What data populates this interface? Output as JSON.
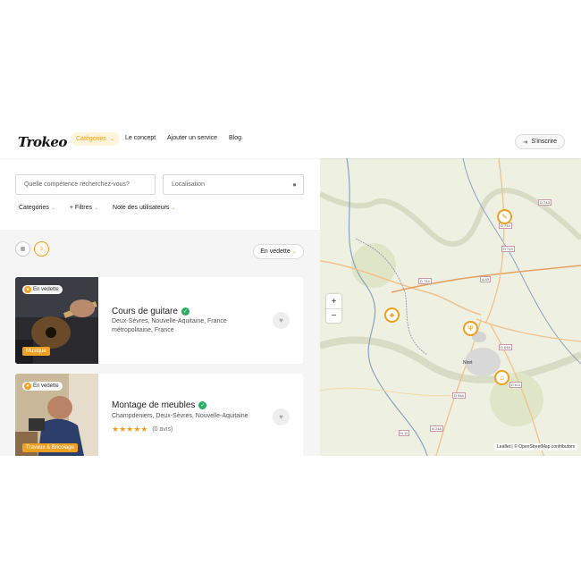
{
  "app": {
    "logo": "Trokeo"
  },
  "header": {
    "nav": [
      "Catégories",
      "Le concept",
      "Ajouter un service",
      "Blog"
    ],
    "signup_label": "S'inscrire"
  },
  "search": {
    "skill_placeholder": "Quelle compétence recherchez-vous?",
    "location_placeholder": "Localisation"
  },
  "filters": [
    "Categories",
    "+ Filtres",
    "Note des utilisateurs"
  ],
  "results": {
    "sort_label": "En vedette",
    "cards": [
      {
        "badge": "En vedette",
        "category": "Musique",
        "title": "Cours de guitare",
        "location": "Deux-Sèvres, Nouvelle-Aquitaine, France métropolitaine, France"
      },
      {
        "badge": "En vedette",
        "category": "Travaux & Bricolage",
        "title": "Montage de meubles",
        "location": "Champdeniers, Deux-Sèvres, Nouvelle-Aquitaine",
        "rating": 5,
        "reviews": "(0 avis)"
      }
    ]
  },
  "map": {
    "zoom_in": "+",
    "zoom_out": "−",
    "attribution": "Leaflet | © OpenStreetMap contributors",
    "city": "Niort",
    "roads": [
      "D 743",
      "D 745",
      "D 749",
      "D 744",
      "A 83",
      "D 648",
      "D 611",
      "D 948",
      "N 11",
      "N 248"
    ],
    "markers": [
      "wrench-icon",
      "plant-icon",
      "fork-knife-icon",
      "music-note-icon"
    ]
  },
  "colors": {
    "accent": "#f0a020",
    "verified": "#27ae60"
  }
}
